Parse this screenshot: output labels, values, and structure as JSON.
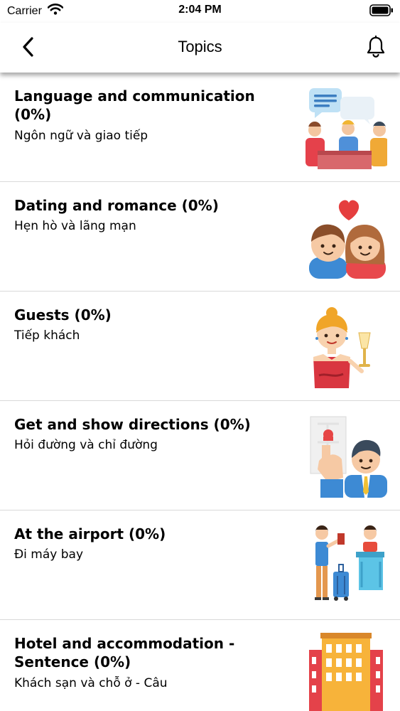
{
  "status_bar": {
    "carrier": "Carrier",
    "time": "2:04 PM"
  },
  "nav": {
    "title": "Topics",
    "back_icon": "chevron-left-icon",
    "bell_icon": "bell-icon"
  },
  "topics": [
    {
      "title": "Language and communication (0%)",
      "subtitle": "Ngôn ngữ và giao tiếp",
      "icon": "people-talking-icon"
    },
    {
      "title": "Dating and romance (0%)",
      "subtitle": "Hẹn hò và lãng mạn",
      "icon": "couple-heart-icon"
    },
    {
      "title": "Guests (0%)",
      "subtitle": "Tiếp khách",
      "icon": "hostess-icon"
    },
    {
      "title": "Get and show directions (0%)",
      "subtitle": "Hỏi đường và chỉ đường",
      "icon": "map-directions-icon"
    },
    {
      "title": "At the airport (0%)",
      "subtitle": "Đi máy bay",
      "icon": "airport-checkin-icon"
    },
    {
      "title": "Hotel and accommodation - Sentence (0%)",
      "subtitle": "Khách sạn và chỗ ở - Câu",
      "icon": "hotel-building-icon"
    }
  ]
}
